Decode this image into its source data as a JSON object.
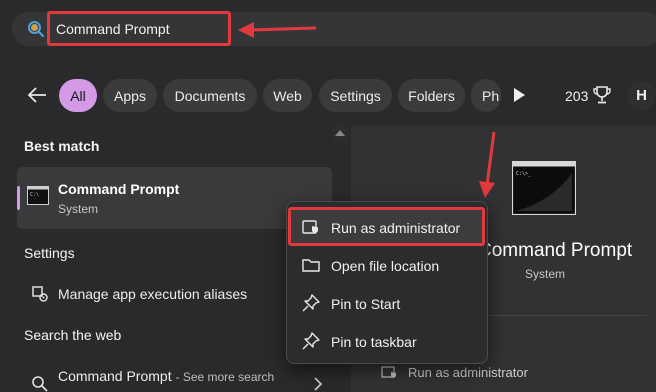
{
  "search": {
    "query": "Command Prompt"
  },
  "filters": {
    "chips": [
      "All",
      "Apps",
      "Documents",
      "Web",
      "Settings",
      "Folders",
      "Ph"
    ],
    "active": "All",
    "rewards_count": "203",
    "avatar_initial": "H"
  },
  "results": {
    "best_match_heading": "Best match",
    "best_match": {
      "title": "Command Prompt",
      "subtitle": "System"
    },
    "settings_heading": "Settings",
    "settings_items": [
      "Manage app execution aliases"
    ],
    "web_heading": "Search the web",
    "web_item": {
      "title": "Command Prompt",
      "hint": "- See more search"
    }
  },
  "preview": {
    "title": "Command Prompt",
    "subtitle": "System",
    "action": "Run as administrator"
  },
  "context_menu": {
    "items": [
      "Run as administrator",
      "Open file location",
      "Pin to Start",
      "Pin to taskbar"
    ]
  },
  "colors": {
    "accent": "#d49ae6",
    "annotation_red": "#e0393e",
    "background": "#2a2a2c"
  },
  "icons": [
    "search-icon",
    "back-arrow-icon",
    "play-icon",
    "trophy-icon",
    "terminal-icon",
    "settings-alias-icon",
    "web-search-icon",
    "shield-icon",
    "folder-icon",
    "pin-icon",
    "chevron-right-icon"
  ]
}
